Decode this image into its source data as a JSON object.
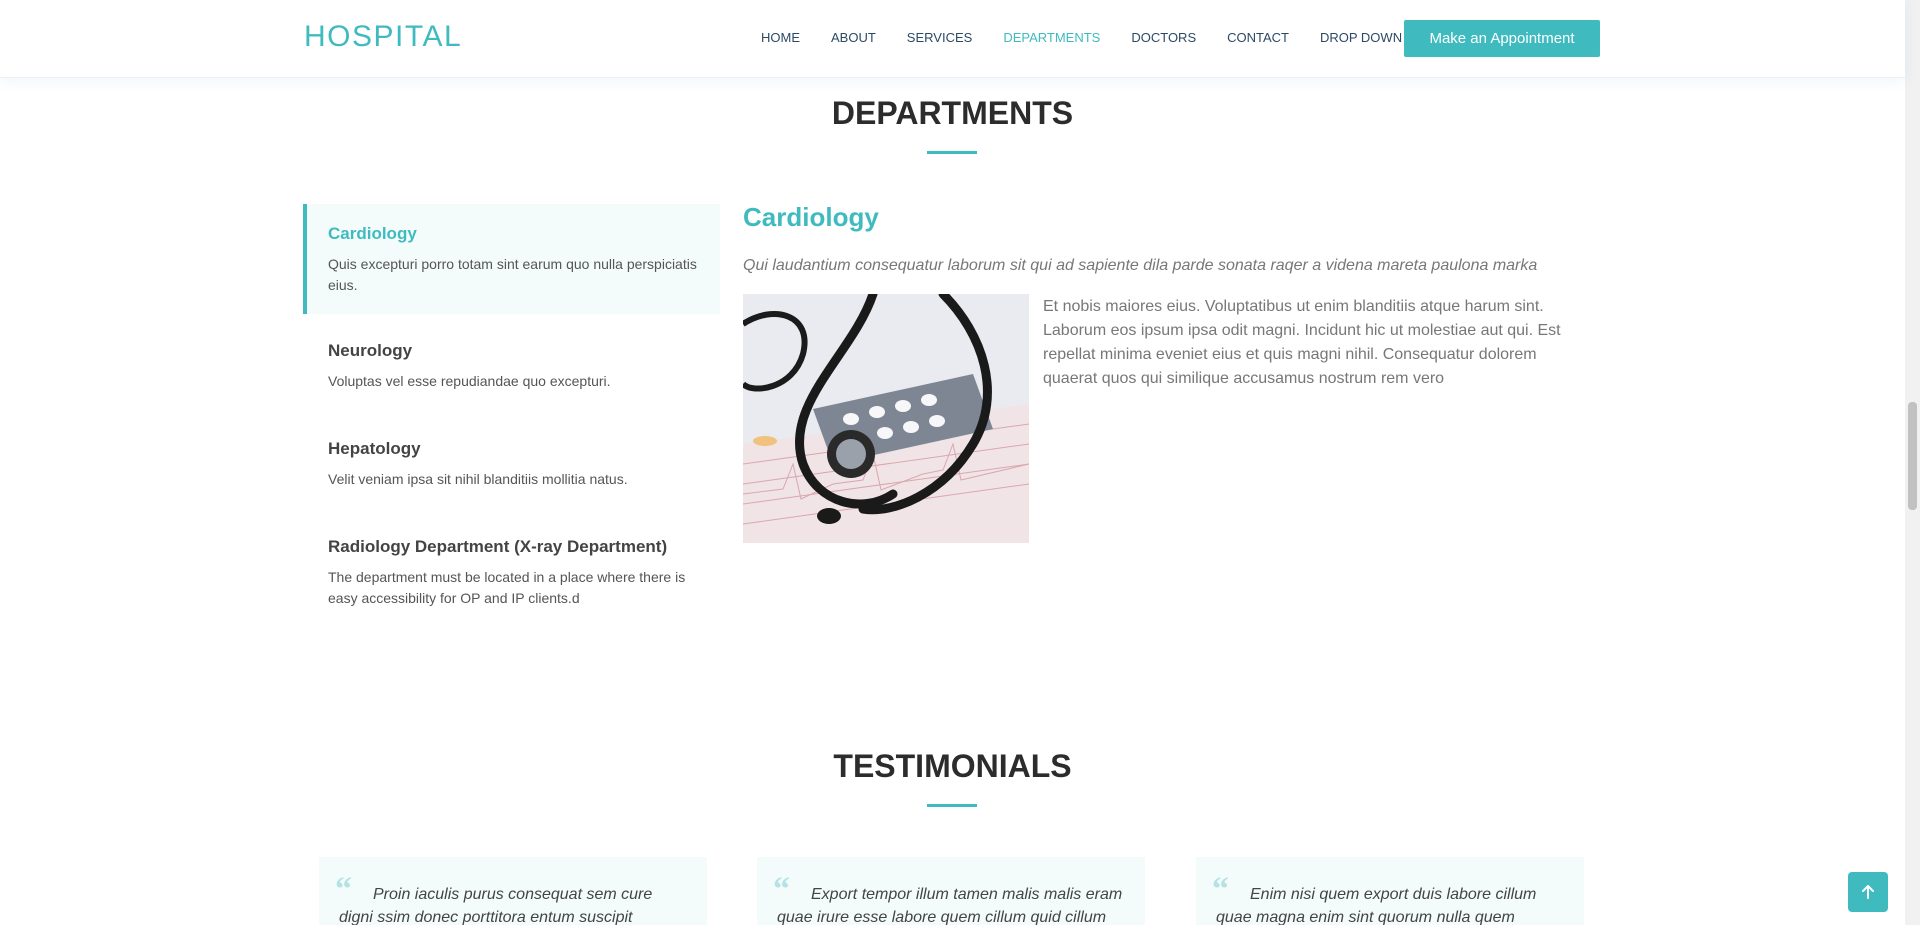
{
  "header": {
    "logo": "HOSPITAL",
    "nav": [
      "HOME",
      "ABOUT",
      "SERVICES",
      "DEPARTMENTS",
      "DOCTORS",
      "CONTACT",
      "DROP DOWN"
    ],
    "active_nav": "DEPARTMENTS",
    "appointment_label": "Make an Appointment"
  },
  "departments": {
    "title": "DEPARTMENTS",
    "tabs": [
      {
        "title": "Cardiology",
        "desc": "Quis excepturi porro totam sint earum quo nulla perspiciatis eius."
      },
      {
        "title": "Neurology",
        "desc": "Voluptas vel esse repudiandae quo excepturi."
      },
      {
        "title": "Hepatology",
        "desc": "Velit veniam ipsa sit nihil blanditiis mollitia natus."
      },
      {
        "title": "Radiology Department (X-ray Department)",
        "desc": "The department must be located in a place where there is easy accessibility for OP and IP clients.d"
      }
    ],
    "detail": {
      "title": "Cardiology",
      "lead": "Qui laudantium consequatur laborum sit qui ad sapiente dila parde sonata raqer a videna mareta paulona marka",
      "body": "Et nobis maiores eius. Voluptatibus ut enim blanditiis atque harum sint. Laborum eos ipsum ipsa odit magni. Incidunt hic ut molestiae aut qui. Est repellat minima eveniet eius et quis magni nihil. Consequatur dolorem quaerat quos qui similique accusamus nostrum rem vero"
    }
  },
  "testimonials": {
    "title": "TESTIMONIALS",
    "items": [
      {
        "text": "Proin iaculis purus consequat sem cure digni ssim donec porttitora entum suscipit rhoncus."
      },
      {
        "text": "Export tempor illum tamen malis malis eram quae irure esse labore quem cillum quid cillum"
      },
      {
        "text": "Enim nisi quem export duis labore cillum quae magna enim sint quorum nulla quem"
      }
    ]
  },
  "colors": {
    "accent": "#3fbbc0",
    "heading": "#2c2c2c",
    "nav": "#2c4964"
  },
  "icons": {
    "dropdown": "chevron-down-icon",
    "quote": "quote-icon",
    "scroll_top": "arrow-up-icon"
  }
}
